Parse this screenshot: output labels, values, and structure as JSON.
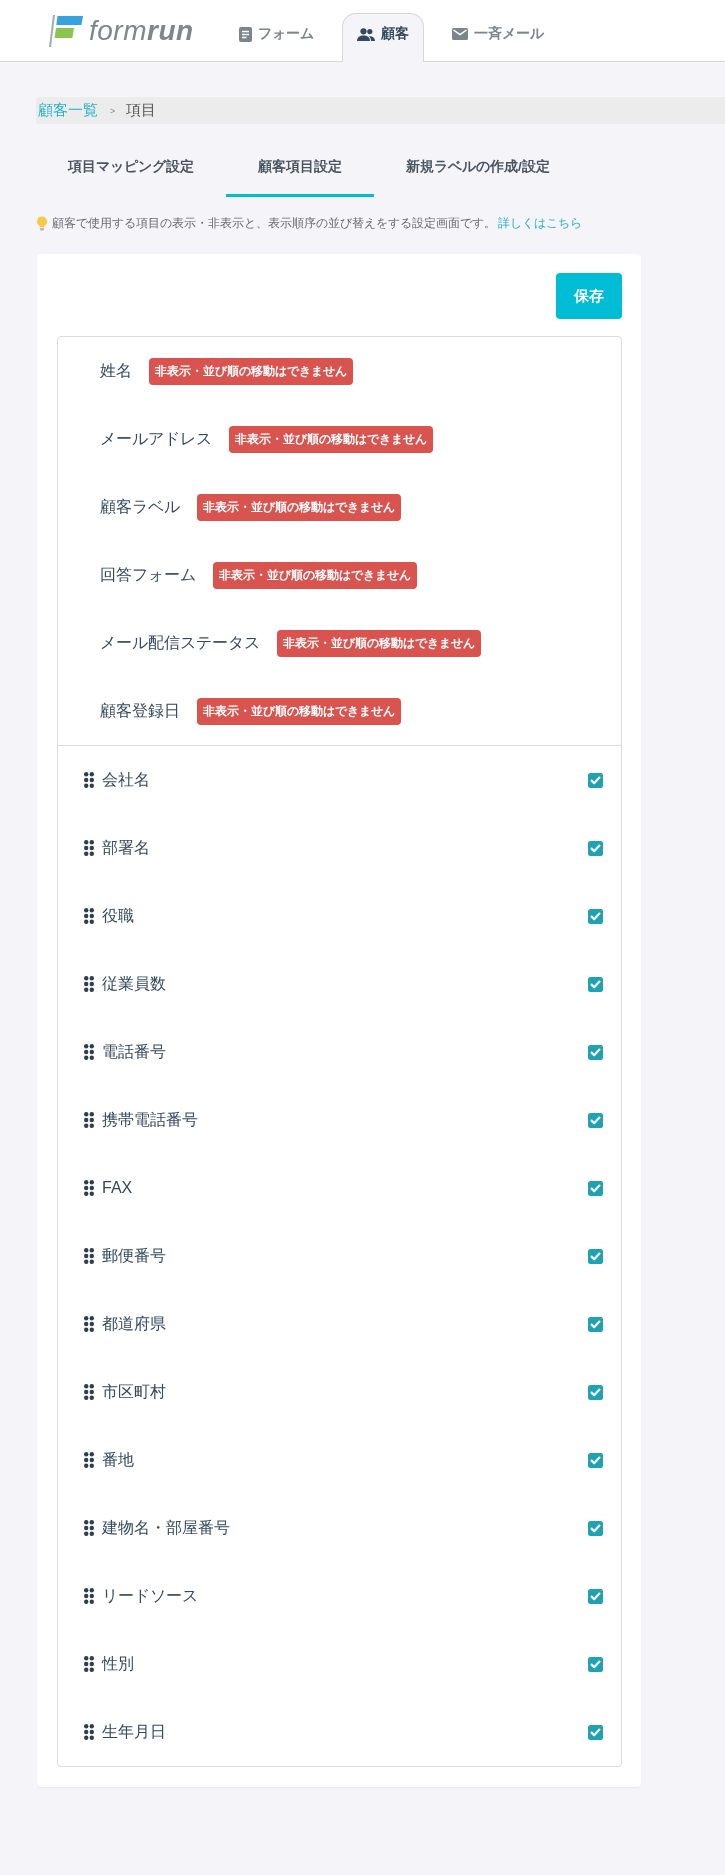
{
  "header": {
    "logo": "form**run**",
    "nav": [
      {
        "label": "フォーム",
        "selected": false
      },
      {
        "label": "顧客",
        "selected": true
      },
      {
        "label": "一斉メール",
        "selected": false
      }
    ]
  },
  "breadcrumb": {
    "items": [
      "顧客一覧",
      "項目"
    ],
    "separator": ">"
  },
  "tabs": [
    {
      "label": "項目マッピング設定",
      "selected": false
    },
    {
      "label": "顧客項目設定",
      "selected": true
    },
    {
      "label": "新規ラベルの作成/設定",
      "selected": false
    }
  ],
  "hint": {
    "text": "顧客で使用する項目の表示・非表示と、表示順序の並び替えをする設定画面です。",
    "link": "詳しくはこちら"
  },
  "save_button": "保存",
  "fixed_fields": [
    {
      "label": "姓名",
      "badge": "非表示・並び順の移動はできません"
    },
    {
      "label": "メールアドレス",
      "badge": "非表示・並び順の移動はできません"
    },
    {
      "label": "顧客ラベル",
      "badge": "非表示・並び順の移動はできません"
    },
    {
      "label": "回答フォーム",
      "badge": "非表示・並び順の移動はできません"
    },
    {
      "label": "メール配信ステータス",
      "badge": "非表示・並び順の移動はできません"
    },
    {
      "label": "顧客登録日",
      "badge": "非表示・並び順の移動はできません"
    }
  ],
  "fields": [
    {
      "label": "会社名",
      "checked": true
    },
    {
      "label": "部署名",
      "checked": true
    },
    {
      "label": "役職",
      "checked": true
    },
    {
      "label": "従業員数",
      "checked": true
    },
    {
      "label": "電話番号",
      "checked": true
    },
    {
      "label": "携帯電話番号",
      "checked": true
    },
    {
      "label": "FAX",
      "checked": true
    },
    {
      "label": "郵便番号",
      "checked": true
    },
    {
      "label": "都道府県",
      "checked": true
    },
    {
      "label": "市区町村",
      "checked": true
    },
    {
      "label": "番地",
      "checked": true
    },
    {
      "label": "建物名・部屋番号",
      "checked": true
    },
    {
      "label": "リードソース",
      "checked": true
    },
    {
      "label": "性別",
      "checked": true
    },
    {
      "label": "生年月日",
      "checked": true
    }
  ]
}
